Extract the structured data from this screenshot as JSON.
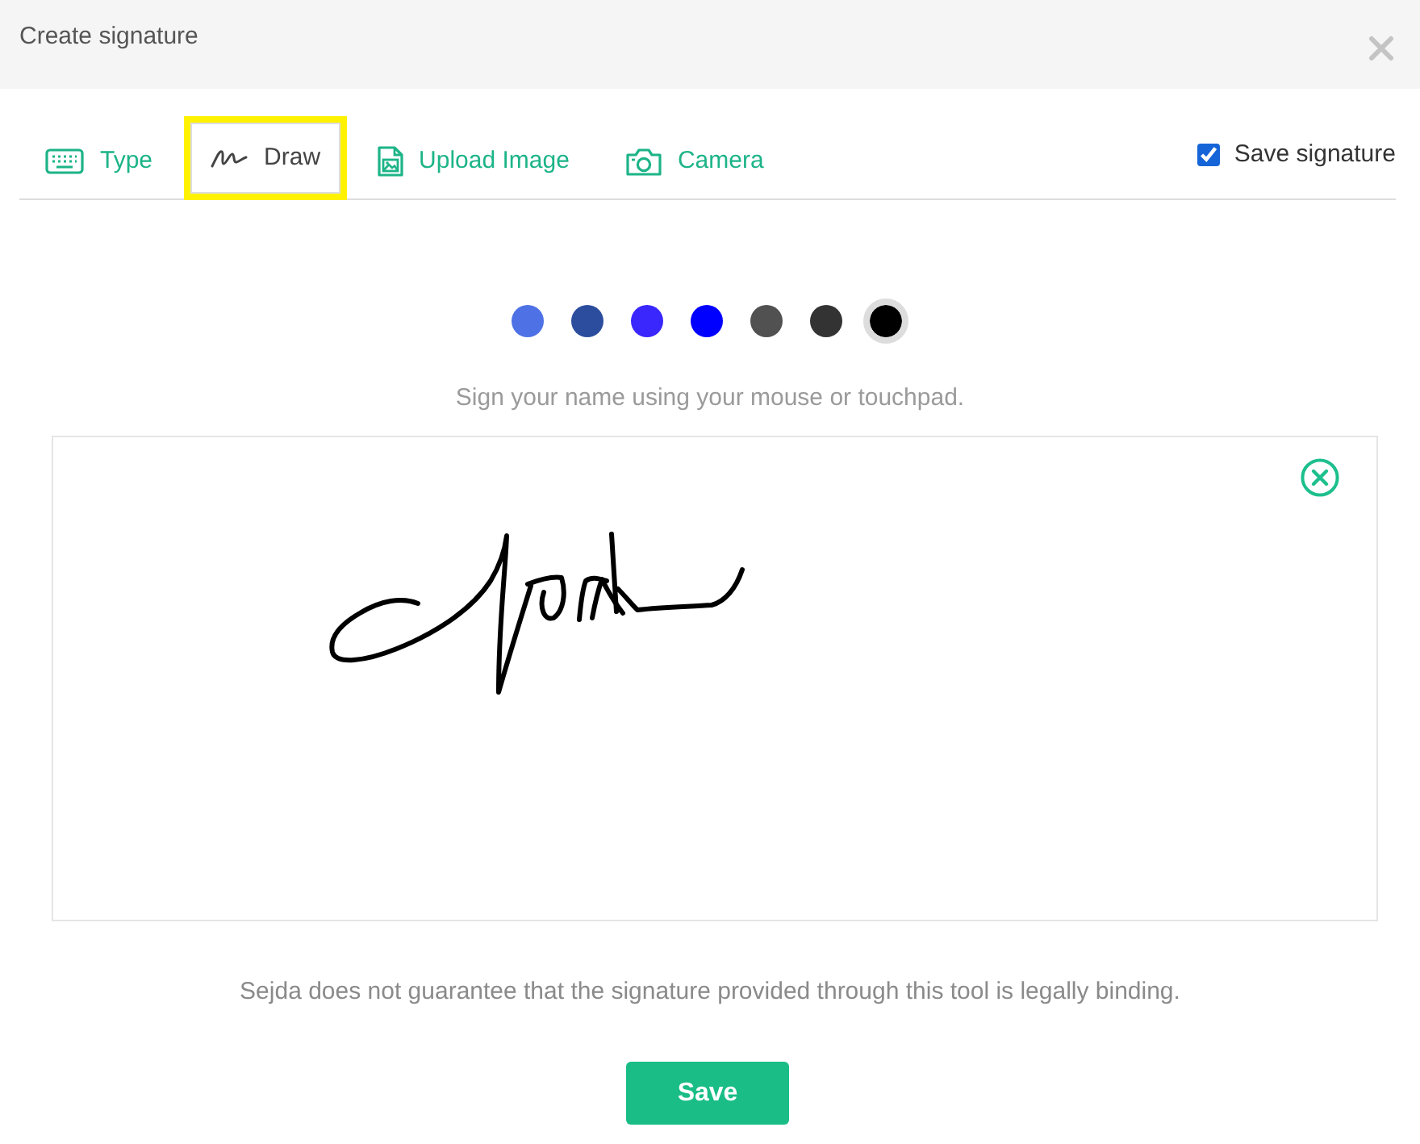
{
  "dialog": {
    "title": "Create signature"
  },
  "tabs": [
    {
      "label": "Type",
      "selected": false,
      "highlighted": false
    },
    {
      "label": "Draw",
      "selected": true,
      "highlighted": true
    },
    {
      "label": "Upload Image",
      "selected": false,
      "highlighted": false
    },
    {
      "label": "Camera",
      "selected": false,
      "highlighted": false
    }
  ],
  "save_signature": {
    "label": "Save signature",
    "checked": true
  },
  "pen_colors": [
    {
      "color": "#4e72e6",
      "selected": false
    },
    {
      "color": "#2c4d9e",
      "selected": false
    },
    {
      "color": "#3a27fd",
      "selected": false
    },
    {
      "color": "#0000ff",
      "selected": false
    },
    {
      "color": "#515151",
      "selected": false
    },
    {
      "color": "#333333",
      "selected": false
    },
    {
      "color": "#000000",
      "selected": true
    }
  ],
  "instruction": "Sign your name using your mouse or touchpad.",
  "disclaimer": "Sejda does not guarantee that the signature provided through this tool is legally binding.",
  "buttons": [
    {
      "label": "Save"
    }
  ]
}
